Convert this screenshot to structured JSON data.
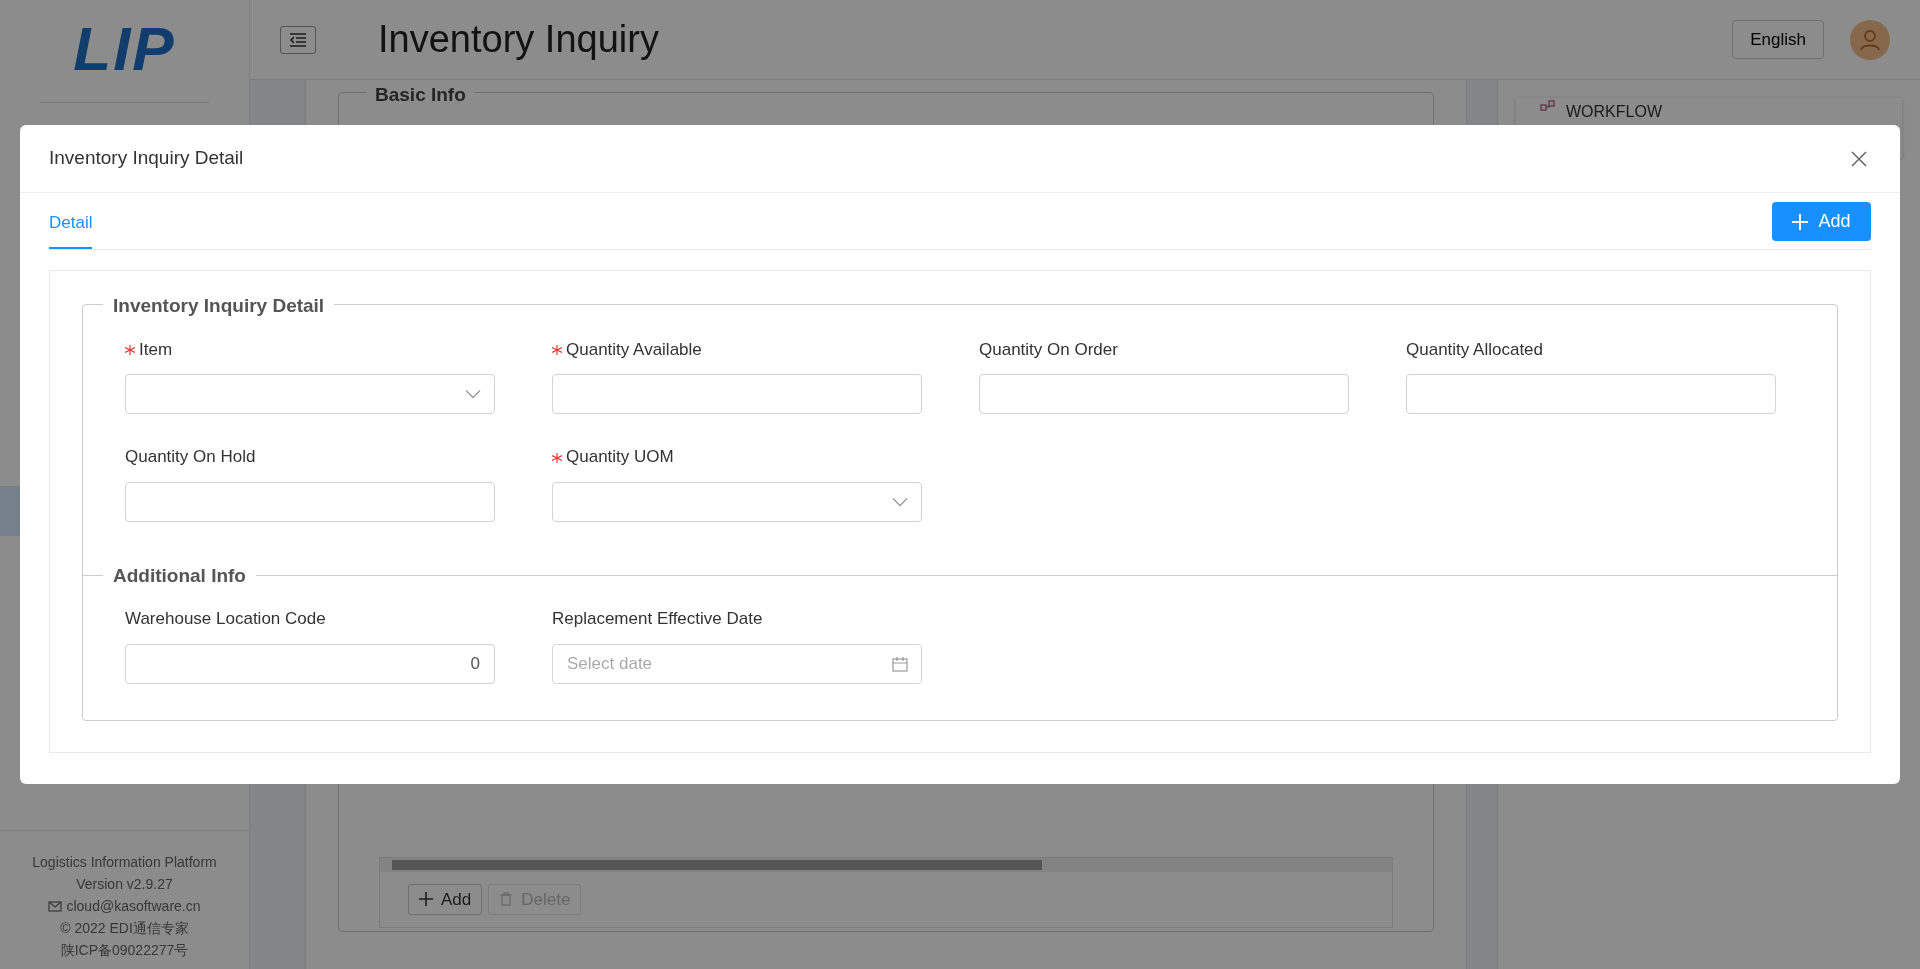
{
  "sidebar": {
    "logo": "LIP",
    "footer": [
      {
        "text": "Logistics Information Platform",
        "kind": "text"
      },
      {
        "text": "Version v2.9.27",
        "kind": "text"
      },
      {
        "text": "cloud@kasoftware.cn",
        "kind": "email"
      },
      {
        "text": "© 2022 EDI通信专家",
        "kind": "text"
      },
      {
        "text": "陕ICP备09022277号",
        "kind": "text"
      }
    ]
  },
  "header": {
    "title": "Inventory Inquiry",
    "language": "English"
  },
  "page": {
    "section_title": "Basic Info",
    "side_panel_title": "WORKFLOW",
    "table_buttons": [
      {
        "label": "Add",
        "kind": "add",
        "disabled": false
      },
      {
        "label": "Delete",
        "kind": "delete",
        "disabled": true
      }
    ]
  },
  "dialog": {
    "title": "Inventory Inquiry Detail",
    "tabs": [
      {
        "label": "Detail",
        "selected": true
      }
    ],
    "add_button": "Add",
    "sections": [
      {
        "title": "Inventory Inquiry Detail",
        "fields": [
          {
            "label": "Item",
            "required": true,
            "kind": "select"
          },
          {
            "label": "Quantity Available",
            "required": true,
            "kind": "text"
          },
          {
            "label": "Quantity On Order",
            "required": false,
            "kind": "text"
          },
          {
            "label": "Quantity Allocated",
            "required": false,
            "kind": "text"
          },
          {
            "label": "Quantity On Hold",
            "required": false,
            "kind": "text"
          },
          {
            "label": "Quantity UOM",
            "required": true,
            "kind": "select"
          }
        ]
      },
      {
        "title": "Additional Info",
        "fields": [
          {
            "label": "Warehouse Location Code",
            "required": false,
            "kind": "number",
            "value": "0"
          },
          {
            "label": "Replacement Effective Date",
            "required": false,
            "kind": "date",
            "placeholder": "Select date"
          }
        ]
      }
    ]
  }
}
